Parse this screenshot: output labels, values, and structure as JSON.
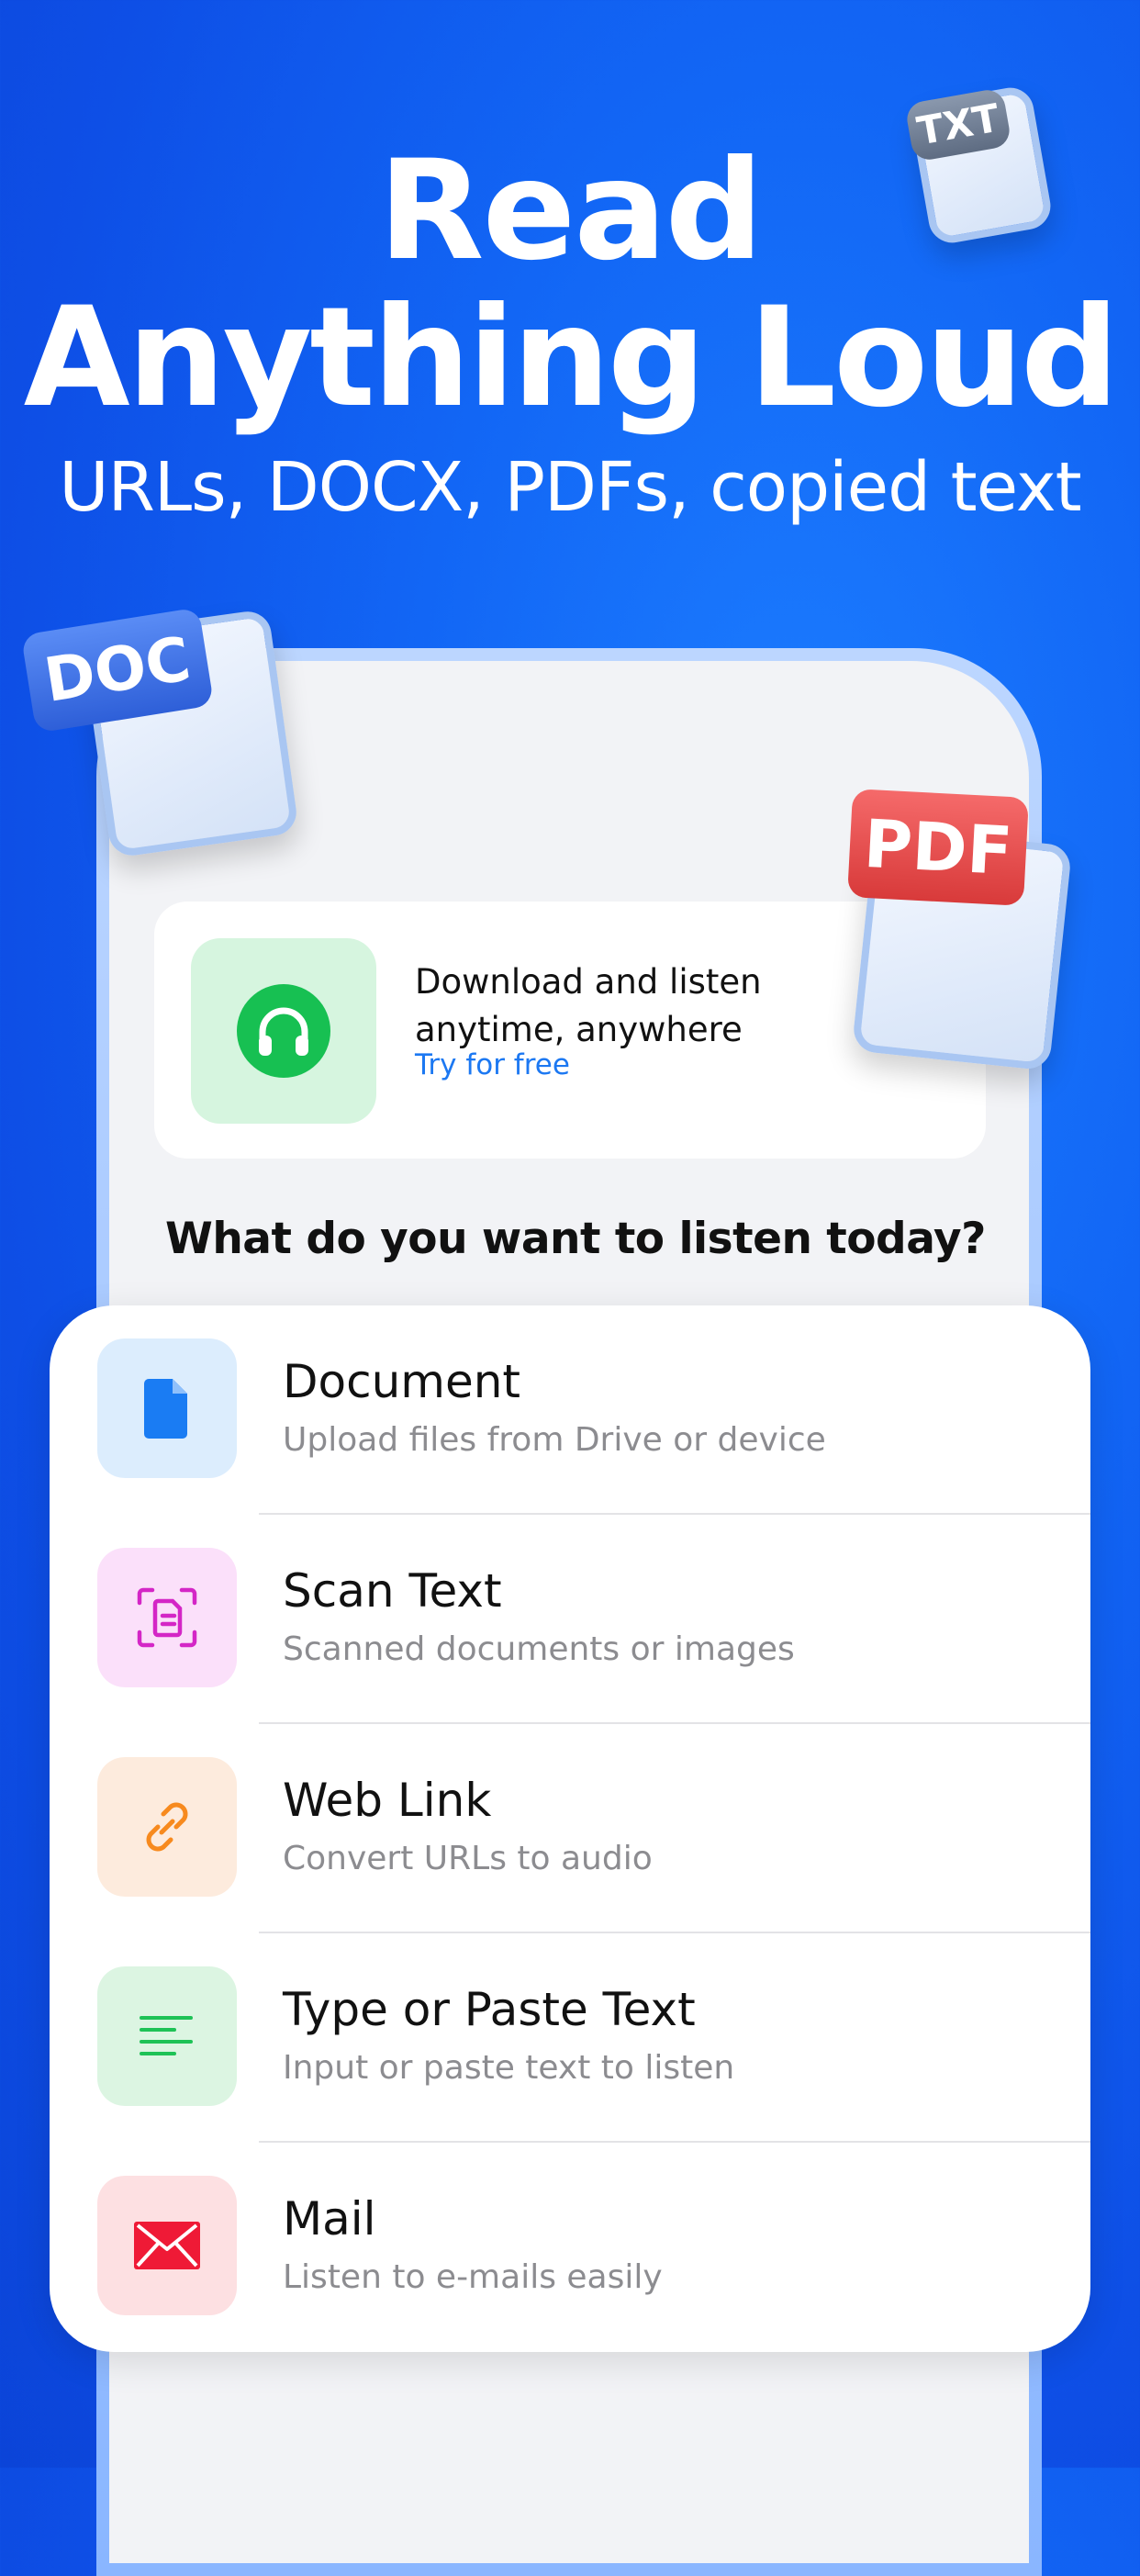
{
  "hero": {
    "title_line1": "Read",
    "title_line2": "Anything Loud",
    "subtitle": "URLs, DOCX, PDFs, copied text"
  },
  "badges": {
    "txt": "TXT",
    "doc": "DOC",
    "pdf": "PDF"
  },
  "promo": {
    "title": "Download and listen anytime, anywhere",
    "cta": "Try for free",
    "icon": "headphones-icon"
  },
  "question": "What do you want to listen today?",
  "sources": [
    {
      "title": "Document",
      "description": "Upload files from Drive or device",
      "icon": "document-icon",
      "icon_color": "#1a7cf3",
      "bg": "#dcedfd"
    },
    {
      "title": "Scan Text",
      "description": "Scanned documents or images",
      "icon": "scan-icon",
      "icon_color": "#d426c6",
      "bg": "#fbe0fa"
    },
    {
      "title": "Web Link",
      "description": "Convert URLs to audio",
      "icon": "link-icon",
      "icon_color": "#f78a1e",
      "bg": "#fdebdd"
    },
    {
      "title": "Type or Paste Text",
      "description": "Input or paste text to listen",
      "icon": "text-lines-icon",
      "icon_color": "#1ec256",
      "bg": "#dcf5e2"
    },
    {
      "title": "Mail",
      "description": "Listen to e-mails easily",
      "icon": "mail-icon",
      "icon_color": "#ef1a36",
      "bg": "#fde0e2"
    }
  ],
  "colors": {
    "background": "#1266f5",
    "accent_link": "#1c78f2",
    "promo_icon_green": "#17c052"
  }
}
